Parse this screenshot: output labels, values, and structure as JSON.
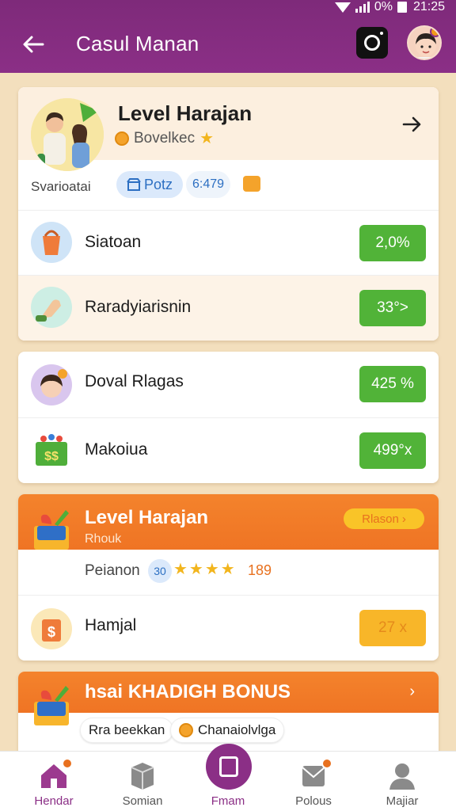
{
  "status_bar": {
    "signal_text": "0%",
    "time": "21:25"
  },
  "app_bar": {
    "title": "Casul Manan"
  },
  "card1": {
    "title": "Level Harajan",
    "subtitle": "Bovelkec",
    "meta_label": "Svarioatai",
    "pill_ports": "Potz",
    "pill_value": "6:479",
    "rows": [
      {
        "label": "Siatoan",
        "value": "2,0%"
      },
      {
        "label": "Raradyiarisnin",
        "value": "33°>"
      }
    ]
  },
  "card2": {
    "rows": [
      {
        "label": "Doval Rlagas",
        "value": "425 %"
      },
      {
        "label": "Makoiua",
        "value": "499°x"
      }
    ]
  },
  "card3": {
    "title": "Level Harajan",
    "subtitle": "Rhouk",
    "bonus_pill": "Rlason",
    "rating_label": "Peianon",
    "rating_badge": "30",
    "rating_count": "189",
    "row": {
      "label": "Hamjal",
      "value": "27 x"
    }
  },
  "card4": {
    "title": "hsai KHADIGH BONUS",
    "tag1": "Rra beekkan",
    "tag2": "Chanaiolvlga"
  },
  "bottom_nav": [
    {
      "label": "Hendar"
    },
    {
      "label": "Somian"
    },
    {
      "label": "Fmam"
    },
    {
      "label": "Polous"
    },
    {
      "label": "Majiar"
    }
  ],
  "colors": {
    "primary": "#8b2f86",
    "accent_orange": "#ef7424",
    "value_green": "#51b338",
    "background": "#f3dfbd"
  }
}
